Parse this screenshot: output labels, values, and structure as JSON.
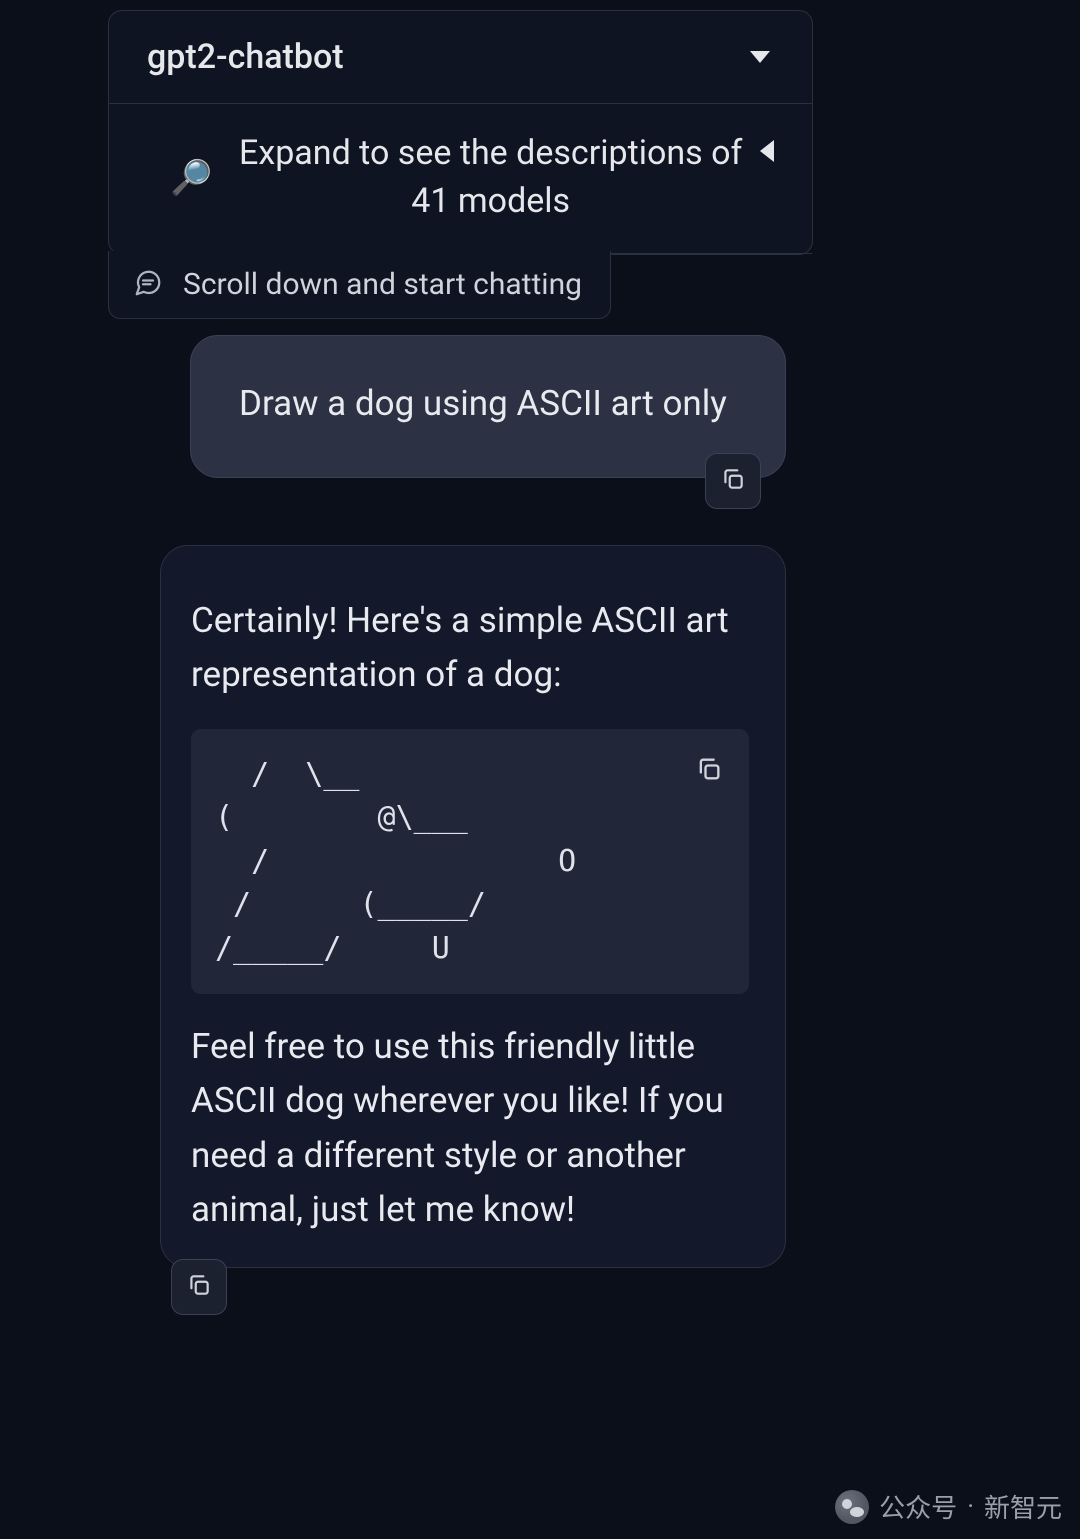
{
  "dropdown": {
    "selected": "gpt2-chatbot"
  },
  "expand": {
    "text": "Expand to see the descriptions of 41 models"
  },
  "hint": {
    "text": "Scroll down and start chatting"
  },
  "user_message": {
    "text": "Draw a dog using ASCII art only"
  },
  "assistant_message": {
    "intro": "Certainly! Here's a simple ASCII art representation of a dog:",
    "code": "  /  \\__\n(        @\\___\n  /                O\n /      (_____/\n/_____/     U",
    "outro": "Feel free to use this friendly little ASCII dog wherever you like! If you need a different style or another animal, just let me know!"
  },
  "watermark": {
    "label": "公众号",
    "dot": "·",
    "source": "新智元"
  }
}
